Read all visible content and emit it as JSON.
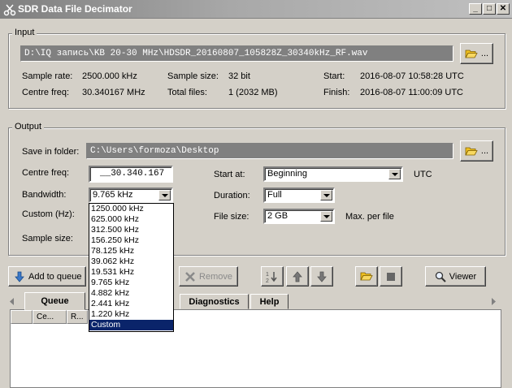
{
  "window": {
    "title": "SDR Data File Decimator",
    "min": "_",
    "max": "□",
    "close": "✕"
  },
  "input": {
    "title": "Input",
    "path": "D:\\IQ запись\\KB 20-30 MHz\\HDSDR_20160807_105828Z_30340kHz_RF.wav",
    "browse_label": "...",
    "sample_rate_label": "Sample rate:",
    "sample_rate_value": "2500.000 kHz",
    "sample_size_label": "Sample size:",
    "sample_size_value": "32 bit",
    "start_label": "Start:",
    "start_value": "2016-08-07 10:58:28 UTC",
    "centre_freq_label": "Centre freq:",
    "centre_freq_value": "30.340167 MHz",
    "total_files_label": "Total files:",
    "total_files_value": "1 (2032 MB)",
    "finish_label": "Finish:",
    "finish_value": "2016-08-07 11:00:09 UTC"
  },
  "output": {
    "title": "Output",
    "save_label": "Save in folder:",
    "save_path": "C:\\Users\\formoza\\Desktop",
    "browse_label": "...",
    "centre_freq_label": "Centre freq:",
    "centre_freq_value": "__30.340.167",
    "bandwidth_label": "Bandwidth:",
    "bandwidth_value": "9.765 kHz",
    "custom_label": "Custom (Hz):",
    "sample_size_label": "Sample size:",
    "start_at_label": "Start at:",
    "start_at_value": "Beginning",
    "utc_label": "UTC",
    "duration_label": "Duration:",
    "duration_value": "Full",
    "file_size_label": "File size:",
    "file_size_value": "2 GB",
    "max_per_file_label": "Max. per file"
  },
  "bandwidth_options": [
    "1250.000 kHz",
    "625.000 kHz",
    "312.500 kHz",
    "156.250 kHz",
    "78.125 kHz",
    "39.062 kHz",
    "19.531 kHz",
    "9.765 kHz",
    "4.882 kHz",
    "2.441 kHz",
    "1.220 kHz",
    "Custom"
  ],
  "toolbar": {
    "add_to_queue": "Add to queue",
    "remove": "Remove",
    "viewer": "Viewer"
  },
  "tabs": {
    "queue": "Queue",
    "diagnostics": "Diagnostics",
    "help": "Help"
  },
  "queue_columns": [
    "Ce...",
    "R..."
  ]
}
